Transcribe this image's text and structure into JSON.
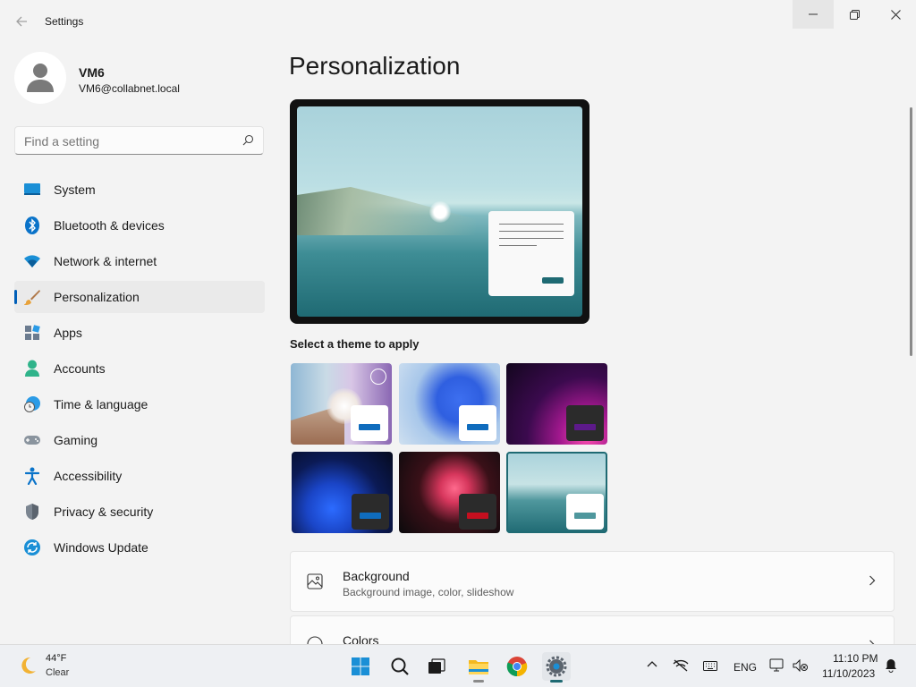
{
  "window": {
    "title": "Settings"
  },
  "user": {
    "name": "VM6",
    "email": "VM6@collabnet.local"
  },
  "search": {
    "placeholder": "Find a setting"
  },
  "nav": {
    "items": [
      {
        "label": "System",
        "icon": "monitor-icon"
      },
      {
        "label": "Bluetooth & devices",
        "icon": "bluetooth-icon"
      },
      {
        "label": "Network & internet",
        "icon": "wifi-icon"
      },
      {
        "label": "Personalization",
        "icon": "brush-icon",
        "active": true
      },
      {
        "label": "Apps",
        "icon": "apps-icon"
      },
      {
        "label": "Accounts",
        "icon": "person-icon"
      },
      {
        "label": "Time & language",
        "icon": "globe-clock-icon"
      },
      {
        "label": "Gaming",
        "icon": "gamepad-icon"
      },
      {
        "label": "Accessibility",
        "icon": "accessibility-icon"
      },
      {
        "label": "Privacy & security",
        "icon": "shield-icon"
      },
      {
        "label": "Windows Update",
        "icon": "update-icon"
      }
    ]
  },
  "main": {
    "title": "Personalization",
    "theme_heading": "Select a theme to apply",
    "themes": [
      {
        "name": "theme-1",
        "accent": "#0f6cbd"
      },
      {
        "name": "theme-2",
        "accent": "#0f6cbd"
      },
      {
        "name": "theme-3",
        "accent": "#5d1a8a"
      },
      {
        "name": "theme-4",
        "accent": "#0f6cbd"
      },
      {
        "name": "theme-5",
        "accent": "#c50f1f"
      },
      {
        "name": "theme-6",
        "accent": "#4f979d",
        "selected": true
      }
    ],
    "cards": [
      {
        "title": "Background",
        "subtitle": "Background image, color, slideshow"
      },
      {
        "title": "Colors"
      }
    ]
  },
  "taskbar": {
    "weather": {
      "temp": "44°F",
      "condition": "Clear"
    },
    "language": "ENG",
    "time": "11:10 PM",
    "date": "11/10/2023"
  },
  "colors": {
    "accent": "#005fb8",
    "selected_theme": "#1f6a73"
  }
}
